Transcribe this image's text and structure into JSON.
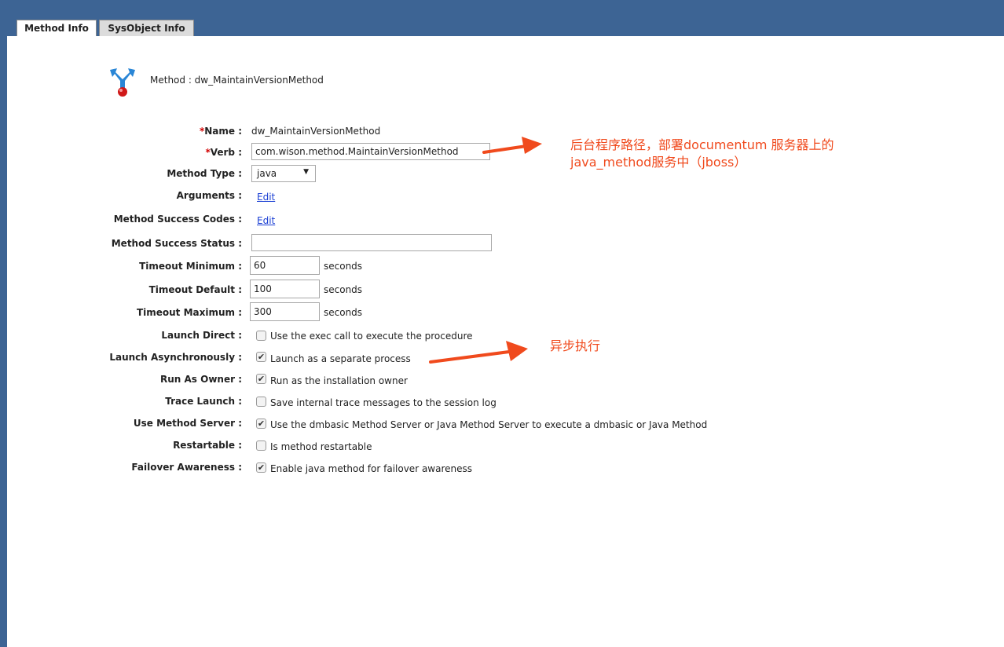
{
  "tabs": [
    {
      "label": "Method Info",
      "active": true
    },
    {
      "label": "SysObject Info",
      "active": false
    }
  ],
  "header": {
    "title": "Method : dw_MaintainVersionMethod"
  },
  "form": {
    "name": {
      "label": "Name :",
      "required_mark": "*",
      "value": "dw_MaintainVersionMethod"
    },
    "verb": {
      "label": "Verb :",
      "required_mark": "*",
      "value": "com.wison.method.MaintainVersionMethod"
    },
    "method_type": {
      "label": "Method Type :",
      "value": "java",
      "arrow": "▼"
    },
    "arguments": {
      "label": "Arguments :",
      "link": "Edit"
    },
    "success_codes": {
      "label": "Method Success Codes :",
      "link": "Edit"
    },
    "success_status": {
      "label": "Method Success Status :",
      "value": ""
    },
    "timeout_min": {
      "label": "Timeout Minimum :",
      "value": "60",
      "unit": "seconds"
    },
    "timeout_default": {
      "label": "Timeout Default :",
      "value": "100",
      "unit": "seconds"
    },
    "timeout_max": {
      "label": "Timeout Maximum :",
      "value": "300",
      "unit": "seconds"
    },
    "launch_direct": {
      "label": "Launch Direct :",
      "checked": false,
      "text": "Use the exec call to execute the procedure"
    },
    "launch_async": {
      "label": "Launch Asynchronously :",
      "checked": true,
      "text": "Launch as a separate process"
    },
    "run_as_owner": {
      "label": "Run As Owner :",
      "checked": true,
      "text": "Run as the installation owner"
    },
    "trace_launch": {
      "label": "Trace Launch :",
      "checked": false,
      "text": "Save internal trace messages to the session log"
    },
    "use_method_server": {
      "label": "Use Method Server :",
      "checked": true,
      "text": "Use the dmbasic Method Server or Java Method Server to execute a dmbasic or Java Method"
    },
    "restartable": {
      "label": "Restartable :",
      "checked": false,
      "text": "Is method restartable"
    },
    "failover": {
      "label": "Failover Awareness :",
      "checked": true,
      "text": "Enable java method for failover awareness"
    }
  },
  "annotations": {
    "verb_note_line1": "后台程序路径，部署documentum 服务器上的",
    "verb_note_line2": "java_method服务中（jboss）",
    "async_note": "异步执行"
  },
  "colors": {
    "header_blue": "#3d6494",
    "annotation": "#f04a1d",
    "link": "#1a3fd4",
    "required": "#d20000"
  }
}
